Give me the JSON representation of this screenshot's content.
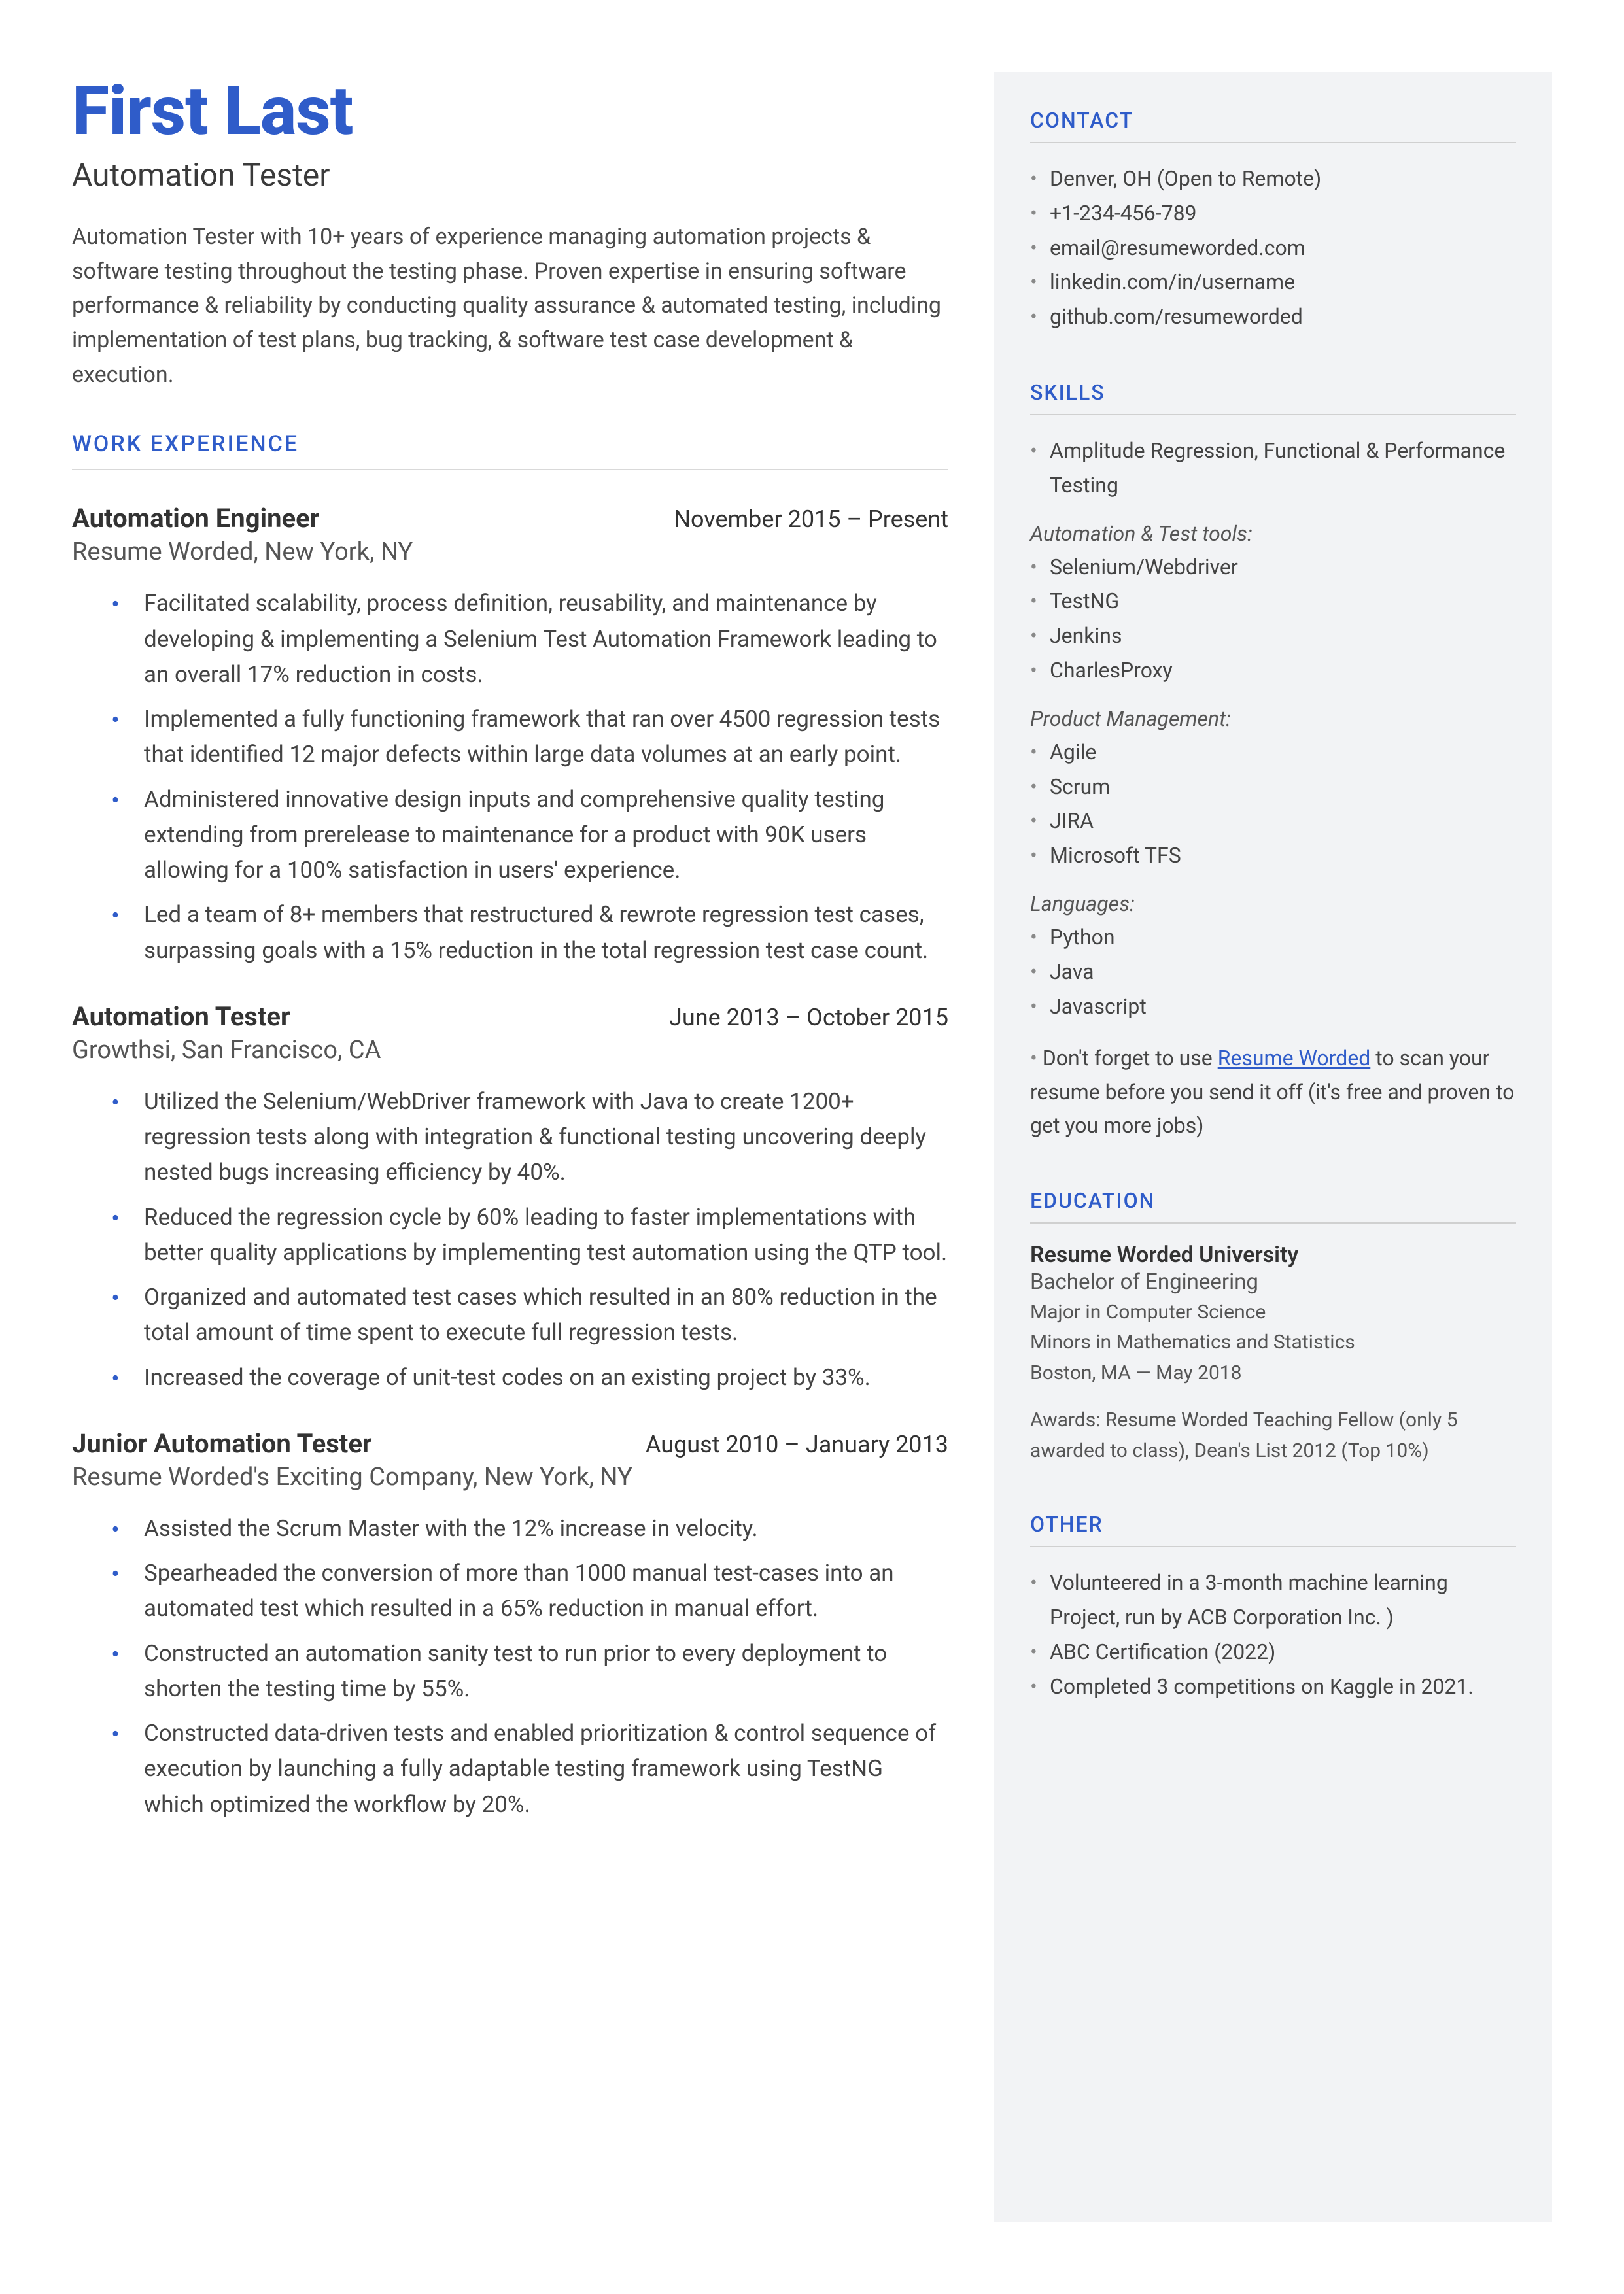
{
  "header": {
    "name": "First Last",
    "title": "Automation Tester",
    "summary": "Automation Tester with 10+ years of experience managing automation projects & software testing throughout the testing phase. Proven expertise in ensuring software performance & reliability by conducting quality assurance & automated testing, including implementation of test plans, bug tracking, & software test case development & execution."
  },
  "sections": {
    "work_heading": "WORK EXPERIENCE",
    "contact_heading": "CONTACT",
    "skills_heading": "SKILLS",
    "education_heading": "EDUCATION",
    "other_heading": "OTHER"
  },
  "jobs": [
    {
      "title": "Automation Engineer",
      "date": "November 2015 – Present",
      "sub": "Resume Worded, New York, NY",
      "bullets": [
        "Facilitated scalability, process definition, reusability, and maintenance by developing & implementing a Selenium Test Automation Framework leading to an overall 17% reduction in costs.",
        "Implemented a fully functioning framework that ran over 4500 regression tests that identified 12 major defects within large data volumes at an early point.",
        "Administered innovative design inputs and comprehensive quality testing extending from prerelease to maintenance for a product with 90K users allowing for a 100% satisfaction in users' experience.",
        "Led a team of 8+ members that restructured & rewrote regression test cases, surpassing goals with a 15% reduction in the total regression test case count."
      ]
    },
    {
      "title": "Automation Tester",
      "date": "June 2013 – October 2015",
      "sub": "Growthsi, San Francisco, CA",
      "bullets": [
        "Utilized the Selenium/WebDriver framework with Java to create 1200+ regression tests along with integration & functional testing uncovering deeply nested bugs increasing efficiency by 40%.",
        "Reduced the regression cycle by 60% leading to faster implementations with better quality applications by implementing test automation using the QTP tool.",
        "Organized and automated test cases which resulted in an 80% reduction in the total amount of time spent to execute full regression tests.",
        "Increased the coverage of unit-test codes on an existing project by 33%."
      ]
    },
    {
      "title": "Junior Automation Tester",
      "date": "August 2010 – January 2013",
      "sub": "Resume Worded's Exciting Company, New York, NY",
      "bullets": [
        "Assisted the Scrum Master with the 12% increase in velocity.",
        "Spearheaded the conversion of more than 1000 manual test-cases into an automated test which resulted in a 65% reduction in manual effort.",
        "Constructed an automation sanity test to run prior to every deployment to shorten the testing time by 55%.",
        "Constructed data-driven tests and enabled prioritization & control sequence of execution by launching a fully adaptable testing framework using TestNG which optimized the workflow by 20%."
      ]
    }
  ],
  "contact": [
    "Denver, OH (Open to Remote)",
    "+1-234-456-789",
    "email@resumeworded.com",
    "linkedin.com/in/username",
    "github.com/resumeworded"
  ],
  "skills": {
    "main": "Amplitude Regression, Functional & Performance Testing",
    "groups": [
      {
        "head": "Automation & Test tools:",
        "items": [
          "Selenium/Webdriver",
          "TestNG",
          "Jenkins",
          "CharlesProxy"
        ]
      },
      {
        "head": "Product Management:",
        "items": [
          "Agile",
          "Scrum",
          "JIRA",
          "Microsoft TFS"
        ]
      },
      {
        "head": "Languages:",
        "items": [
          "Python",
          "Java",
          "Javascript"
        ]
      }
    ],
    "note_pre": "Don't forget to use ",
    "note_link": "Resume Worded",
    "note_post": " to scan your resume before you send it off (it's free and proven to get you more jobs)"
  },
  "education": {
    "uni": "Resume Worded University",
    "degree": "Bachelor of Engineering",
    "major": "Major in Computer Science",
    "minors": "Minors in Mathematics and Statistics",
    "loc": "Boston, MA — May 2018",
    "awards": "Awards: Resume Worded Teaching Fellow (only 5 awarded to class), Dean's List 2012 (Top 10%)"
  },
  "other": [
    "Volunteered in a 3-month machine learning Project, run by ACB Corporation Inc. )",
    "ABC Certification (2022)",
    "Completed 3 competitions on Kaggle in 2021."
  ]
}
